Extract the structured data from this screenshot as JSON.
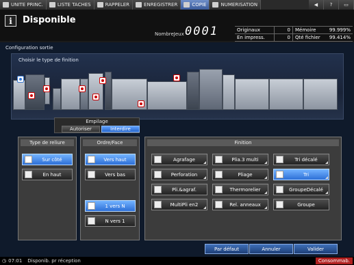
{
  "tabs": [
    {
      "label": "UNITE PRINC.",
      "icon": "home-icon",
      "active": false
    },
    {
      "label": "LISTE TACHES",
      "icon": "job-list-icon",
      "active": false
    },
    {
      "label": "RAPPELER",
      "icon": "recall-icon",
      "active": false
    },
    {
      "label": "ENREGISTRER",
      "icon": "register-icon",
      "active": false
    },
    {
      "label": "COPIE",
      "icon": "copy-icon",
      "active": true
    },
    {
      "label": "NUMERISATION",
      "icon": "scan-icon",
      "active": false
    }
  ],
  "header": {
    "status": "Disponible",
    "jobs_label": "NombreJeux",
    "jobs_value": "0001",
    "counters": [
      {
        "label": "Originaux",
        "value": "0",
        "label2": "Mémoire",
        "value2": "99.999%"
      },
      {
        "label": "En impress.",
        "value": "0",
        "label2": "Qté fichier",
        "value2": "99.414%"
      }
    ]
  },
  "panel": {
    "title": "Configuration sortie",
    "prompt": "Choisir le type de finition"
  },
  "empilage": {
    "title": "Empilage",
    "options": [
      "Autoriser",
      "Interdire"
    ],
    "selected": "Interdire"
  },
  "reliure": {
    "title": "Type de reliure",
    "buttons": [
      {
        "label": "Sur côté",
        "selected": true
      },
      {
        "label": "En haut",
        "selected": false
      }
    ]
  },
  "ordre": {
    "title": "Ordre/Face",
    "buttons": [
      {
        "label": "Vers haut",
        "selected": true
      },
      {
        "label": "Vers bas",
        "selected": false
      },
      {
        "label": "1 vers N",
        "selected": true
      },
      {
        "label": "N vers 1",
        "selected": false
      }
    ]
  },
  "finition": {
    "title": "Finition",
    "buttons": [
      {
        "label": "Agrafage",
        "selected": false
      },
      {
        "label": "Plia.3 multi",
        "selected": false
      },
      {
        "label": "Tri décalé",
        "selected": false
      },
      {
        "label": "Perforation",
        "selected": false
      },
      {
        "label": "Pliage",
        "selected": false
      },
      {
        "label": "Tri",
        "selected": true
      },
      {
        "label": "Pli.&agraf.",
        "selected": false
      },
      {
        "label": "Thermorelier",
        "selected": false
      },
      {
        "label": "GroupeDécalé",
        "selected": false
      },
      {
        "label": "MultiPli en2",
        "selected": false
      },
      {
        "label": "Rel. anneaux",
        "selected": false
      },
      {
        "label": "Groupe",
        "selected": false
      }
    ]
  },
  "footer": {
    "default_label": "Par défaut",
    "cancel_label": "Annuler",
    "ok_label": "Valider"
  },
  "statusbar": {
    "time": "07:01",
    "message": "Disponib. pr réception",
    "consumables": "Consommab."
  },
  "colors": {
    "selected": "#2d6fd6",
    "panel_bg": "#0f1a2b",
    "alert": "#b02020"
  }
}
